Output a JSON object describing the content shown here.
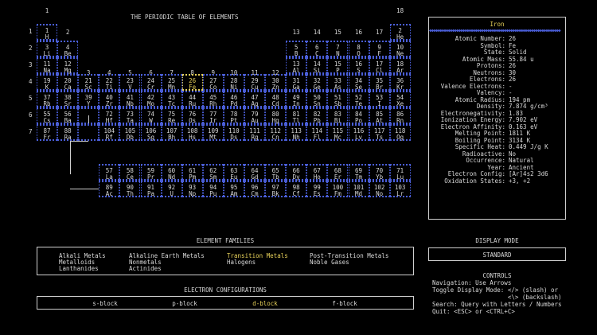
{
  "table_title": "THE PERIODIC TABLE OF ELEMENTS",
  "group_numbers": [
    "1",
    "2",
    "3",
    "4",
    "5",
    "6",
    "7",
    "8",
    "9",
    "10",
    "11",
    "12",
    "13",
    "14",
    "15",
    "16",
    "17",
    "18"
  ],
  "period_numbers": [
    "1",
    "2",
    "3",
    "4",
    "5",
    "6",
    "7"
  ],
  "elements": [
    {
      "n": "1",
      "s": "H",
      "g": 1,
      "p": 1
    },
    {
      "n": "2",
      "s": "He",
      "g": 18,
      "p": 1
    },
    {
      "n": "3",
      "s": "Li",
      "g": 1,
      "p": 2
    },
    {
      "n": "4",
      "s": "Be",
      "g": 2,
      "p": 2
    },
    {
      "n": "5",
      "s": "B",
      "g": 13,
      "p": 2
    },
    {
      "n": "6",
      "s": "C",
      "g": 14,
      "p": 2
    },
    {
      "n": "7",
      "s": "N",
      "g": 15,
      "p": 2
    },
    {
      "n": "8",
      "s": "O",
      "g": 16,
      "p": 2
    },
    {
      "n": "9",
      "s": "F",
      "g": 17,
      "p": 2
    },
    {
      "n": "10",
      "s": "Ne",
      "g": 18,
      "p": 2
    },
    {
      "n": "11",
      "s": "Na",
      "g": 1,
      "p": 3
    },
    {
      "n": "12",
      "s": "Mg",
      "g": 2,
      "p": 3
    },
    {
      "n": "13",
      "s": "Al",
      "g": 13,
      "p": 3
    },
    {
      "n": "14",
      "s": "Si",
      "g": 14,
      "p": 3
    },
    {
      "n": "15",
      "s": "P",
      "g": 15,
      "p": 3
    },
    {
      "n": "16",
      "s": "S",
      "g": 16,
      "p": 3
    },
    {
      "n": "17",
      "s": "Cl",
      "g": 17,
      "p": 3
    },
    {
      "n": "18",
      "s": "Ar",
      "g": 18,
      "p": 3
    },
    {
      "n": "19",
      "s": "K",
      "g": 1,
      "p": 4
    },
    {
      "n": "20",
      "s": "Ca",
      "g": 2,
      "p": 4
    },
    {
      "n": "21",
      "s": "Sc",
      "g": 3,
      "p": 4
    },
    {
      "n": "22",
      "s": "Ti",
      "g": 4,
      "p": 4
    },
    {
      "n": "23",
      "s": "V",
      "g": 5,
      "p": 4
    },
    {
      "n": "24",
      "s": "Cr",
      "g": 6,
      "p": 4
    },
    {
      "n": "25",
      "s": "Mn",
      "g": 7,
      "p": 4
    },
    {
      "n": "26",
      "s": "Fe",
      "g": 8,
      "p": 4
    },
    {
      "n": "27",
      "s": "Co",
      "g": 9,
      "p": 4
    },
    {
      "n": "28",
      "s": "Ni",
      "g": 10,
      "p": 4
    },
    {
      "n": "29",
      "s": "Cu",
      "g": 11,
      "p": 4
    },
    {
      "n": "30",
      "s": "Zn",
      "g": 12,
      "p": 4
    },
    {
      "n": "31",
      "s": "Ga",
      "g": 13,
      "p": 4
    },
    {
      "n": "32",
      "s": "Ge",
      "g": 14,
      "p": 4
    },
    {
      "n": "33",
      "s": "As",
      "g": 15,
      "p": 4
    },
    {
      "n": "34",
      "s": "Se",
      "g": 16,
      "p": 4
    },
    {
      "n": "35",
      "s": "Br",
      "g": 17,
      "p": 4
    },
    {
      "n": "36",
      "s": "Kr",
      "g": 18,
      "p": 4
    },
    {
      "n": "37",
      "s": "Rb",
      "g": 1,
      "p": 5
    },
    {
      "n": "38",
      "s": "Sr",
      "g": 2,
      "p": 5
    },
    {
      "n": "39",
      "s": "Y",
      "g": 3,
      "p": 5
    },
    {
      "n": "40",
      "s": "Zr",
      "g": 4,
      "p": 5
    },
    {
      "n": "41",
      "s": "Nb",
      "g": 5,
      "p": 5
    },
    {
      "n": "42",
      "s": "Mo",
      "g": 6,
      "p": 5
    },
    {
      "n": "43",
      "s": "Tc",
      "g": 7,
      "p": 5
    },
    {
      "n": "44",
      "s": "Ru",
      "g": 8,
      "p": 5
    },
    {
      "n": "45",
      "s": "Rh",
      "g": 9,
      "p": 5
    },
    {
      "n": "46",
      "s": "Pd",
      "g": 10,
      "p": 5
    },
    {
      "n": "47",
      "s": "Ag",
      "g": 11,
      "p": 5
    },
    {
      "n": "48",
      "s": "Cd",
      "g": 12,
      "p": 5
    },
    {
      "n": "49",
      "s": "In",
      "g": 13,
      "p": 5
    },
    {
      "n": "50",
      "s": "Sn",
      "g": 14,
      "p": 5
    },
    {
      "n": "51",
      "s": "Sb",
      "g": 15,
      "p": 5
    },
    {
      "n": "52",
      "s": "Te",
      "g": 16,
      "p": 5
    },
    {
      "n": "53",
      "s": "I",
      "g": 17,
      "p": 5
    },
    {
      "n": "54",
      "s": "Xe",
      "g": 18,
      "p": 5
    },
    {
      "n": "55",
      "s": "Cs",
      "g": 1,
      "p": 6
    },
    {
      "n": "56",
      "s": "Ba",
      "g": 2,
      "p": 6
    },
    {
      "n": "72",
      "s": "Hf",
      "g": 4,
      "p": 6
    },
    {
      "n": "73",
      "s": "Ta",
      "g": 5,
      "p": 6
    },
    {
      "n": "74",
      "s": "W",
      "g": 6,
      "p": 6
    },
    {
      "n": "75",
      "s": "Re",
      "g": 7,
      "p": 6
    },
    {
      "n": "76",
      "s": "Os",
      "g": 8,
      "p": 6
    },
    {
      "n": "77",
      "s": "Ir",
      "g": 9,
      "p": 6
    },
    {
      "n": "78",
      "s": "Pt",
      "g": 10,
      "p": 6
    },
    {
      "n": "79",
      "s": "Au",
      "g": 11,
      "p": 6
    },
    {
      "n": "80",
      "s": "Hg",
      "g": 12,
      "p": 6
    },
    {
      "n": "81",
      "s": "Tl",
      "g": 13,
      "p": 6
    },
    {
      "n": "82",
      "s": "Pb",
      "g": 14,
      "p": 6
    },
    {
      "n": "83",
      "s": "Bi",
      "g": 15,
      "p": 6
    },
    {
      "n": "84",
      "s": "Po",
      "g": 16,
      "p": 6
    },
    {
      "n": "85",
      "s": "At",
      "g": 17,
      "p": 6
    },
    {
      "n": "86",
      "s": "Rn",
      "g": 18,
      "p": 6
    },
    {
      "n": "87",
      "s": "Fr",
      "g": 1,
      "p": 7
    },
    {
      "n": "88",
      "s": "Ra",
      "g": 2,
      "p": 7
    },
    {
      "n": "104",
      "s": "Rf",
      "g": 4,
      "p": 7
    },
    {
      "n": "105",
      "s": "Db",
      "g": 5,
      "p": 7
    },
    {
      "n": "106",
      "s": "Sg",
      "g": 6,
      "p": 7
    },
    {
      "n": "107",
      "s": "Bh",
      "g": 7,
      "p": 7
    },
    {
      "n": "108",
      "s": "Hs",
      "g": 8,
      "p": 7
    },
    {
      "n": "109",
      "s": "Mt",
      "g": 9,
      "p": 7
    },
    {
      "n": "110",
      "s": "Ds",
      "g": 10,
      "p": 7
    },
    {
      "n": "111",
      "s": "Rg",
      "g": 11,
      "p": 7
    },
    {
      "n": "112",
      "s": "Cn",
      "g": 12,
      "p": 7
    },
    {
      "n": "113",
      "s": "Nh",
      "g": 13,
      "p": 7
    },
    {
      "n": "114",
      "s": "Fl",
      "g": 14,
      "p": 7
    },
    {
      "n": "115",
      "s": "Mc",
      "g": 15,
      "p": 7
    },
    {
      "n": "116",
      "s": "Lv",
      "g": 16,
      "p": 7
    },
    {
      "n": "117",
      "s": "Ts",
      "g": 17,
      "p": 7
    },
    {
      "n": "118",
      "s": "Og",
      "g": 18,
      "p": 7
    },
    {
      "n": "57",
      "s": "La",
      "g": 4,
      "p": 8
    },
    {
      "n": "58",
      "s": "Ce",
      "g": 5,
      "p": 8
    },
    {
      "n": "59",
      "s": "Pr",
      "g": 6,
      "p": 8
    },
    {
      "n": "60",
      "s": "Nd",
      "g": 7,
      "p": 8
    },
    {
      "n": "61",
      "s": "Pm",
      "g": 8,
      "p": 8
    },
    {
      "n": "62",
      "s": "Sm",
      "g": 9,
      "p": 8
    },
    {
      "n": "63",
      "s": "Eu",
      "g": 10,
      "p": 8
    },
    {
      "n": "64",
      "s": "Gd",
      "g": 11,
      "p": 8
    },
    {
      "n": "65",
      "s": "Tb",
      "g": 12,
      "p": 8
    },
    {
      "n": "66",
      "s": "Dy",
      "g": 13,
      "p": 8
    },
    {
      "n": "67",
      "s": "Ho",
      "g": 14,
      "p": 8
    },
    {
      "n": "68",
      "s": "Er",
      "g": 15,
      "p": 8
    },
    {
      "n": "69",
      "s": "Tm",
      "g": 16,
      "p": 8
    },
    {
      "n": "70",
      "s": "Yb",
      "g": 17,
      "p": 8
    },
    {
      "n": "71",
      "s": "Lu",
      "g": 18,
      "p": 8
    },
    {
      "n": "89",
      "s": "Ac",
      "g": 4,
      "p": 9
    },
    {
      "n": "90",
      "s": "Th",
      "g": 5,
      "p": 9
    },
    {
      "n": "91",
      "s": "Pa",
      "g": 6,
      "p": 9
    },
    {
      "n": "92",
      "s": "U",
      "g": 7,
      "p": 9
    },
    {
      "n": "93",
      "s": "Np",
      "g": 8,
      "p": 9
    },
    {
      "n": "94",
      "s": "Pu",
      "g": 9,
      "p": 9
    },
    {
      "n": "95",
      "s": "Am",
      "g": 10,
      "p": 9
    },
    {
      "n": "96",
      "s": "Cm",
      "g": 11,
      "p": 9
    },
    {
      "n": "97",
      "s": "Bk",
      "g": 12,
      "p": 9
    },
    {
      "n": "98",
      "s": "Cf",
      "g": 13,
      "p": 9
    },
    {
      "n": "99",
      "s": "Es",
      "g": 14,
      "p": 9
    },
    {
      "n": "100",
      "s": "Fm",
      "g": 15,
      "p": 9
    },
    {
      "n": "101",
      "s": "Md",
      "g": 16,
      "p": 9
    },
    {
      "n": "102",
      "s": "No",
      "g": 17,
      "p": 9
    },
    {
      "n": "103",
      "s": "Lr",
      "g": 18,
      "p": 9
    }
  ],
  "selected_symbol": "Fe",
  "info": {
    "title": "Iron",
    "rows": [
      {
        "k": "Atomic Number:",
        "v": "26"
      },
      {
        "k": "Symbol:",
        "v": "Fe"
      },
      {
        "k": "State:",
        "v": "Solid"
      },
      {
        "k": "Atomic Mass:",
        "v": "55.84 u"
      },
      {
        "k": "Protons:",
        "v": "26"
      },
      {
        "k": "Neutrons:",
        "v": "30"
      },
      {
        "k": "Electrons:",
        "v": "26"
      },
      {
        "k": "Valence Electrons:",
        "v": "-"
      },
      {
        "k": "Valency:",
        "v": "-"
      },
      {
        "k": "Atomic Radius:",
        "v": "194 pm"
      },
      {
        "k": "Density:",
        "v": "7.874 g/cm³"
      },
      {
        "k": "Electronegativity:",
        "v": "1.83"
      },
      {
        "k": "Ionization Energy:",
        "v": "7.902 eV"
      },
      {
        "k": "Electron Affinity:",
        "v": "0.163 eV"
      },
      {
        "k": "Melting Point:",
        "v": "1811 K"
      },
      {
        "k": "Boiling Point:",
        "v": "3134 K"
      },
      {
        "k": "Specific Heat:",
        "v": "0.449 J/g K"
      },
      {
        "k": "Radioactive:",
        "v": "No"
      },
      {
        "k": "Occurrence:",
        "v": "Natural"
      },
      {
        "k": "Year:",
        "v": "Ancient"
      },
      {
        "k": "Electron Config:",
        "v": "[Ar]4s2 3d6"
      },
      {
        "k": "Oxidation States:",
        "v": "+3, +2"
      }
    ]
  },
  "families": {
    "title": "ELEMENT FAMILIES",
    "items": [
      "Alkali Metals",
      "Alkaline Earth Metals",
      "Transition Metals",
      "Post-Transition Metals",
      "Metalloids",
      "Nonmetals",
      "Halogens",
      "Noble Gases",
      "Lanthanides",
      "Actinides"
    ],
    "active": "Transition Metals"
  },
  "configs": {
    "title": "ELECTRON CONFIGURATIONS",
    "items": [
      "s-block",
      "p-block",
      "d-block",
      "f-block"
    ],
    "active": "d-block"
  },
  "display_mode": {
    "title": "DISPLAY MODE",
    "value": "STANDARD"
  },
  "controls": {
    "title": "CONTROLS",
    "lines": [
      "Navigation: Use Arrows",
      "Toggle Display Mode: </> (slash) or",
      "                     <\\> (backslash)",
      "Search: Query with Letters / Numbers",
      "Quit: <ESC> or <CTRL+C>"
    ]
  },
  "colors": {
    "accent": "#e8d25a",
    "grid": "#4a5ed8",
    "text": "#d8d8d8",
    "background": "#000000"
  }
}
